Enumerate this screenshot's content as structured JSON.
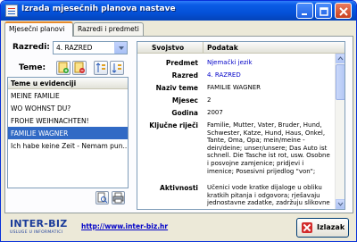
{
  "window": {
    "title": "Izrada mjesečnih planova nastave"
  },
  "tabs": [
    {
      "label": "Mjesečni planovi"
    },
    {
      "label": "Razredi i predmeti"
    }
  ],
  "razredi": {
    "label": "Razredi:",
    "selected": "4. RAZRED"
  },
  "teme": {
    "label": "Teme:"
  },
  "list": {
    "header": "Teme u evidenciji",
    "items": [
      "MEINE FAMILIE",
      "WO WOHNST DU?",
      "FROHE WEIHNACHTEN!",
      "FAMILIE WAGNER",
      "Ich habe keine Zeit - Nemam pun..."
    ],
    "selected_index": 3
  },
  "grid": {
    "col_svojstvo": "Svojstvo",
    "col_podatak": "Podatak",
    "rows": [
      {
        "key": "Predmet",
        "value": "Njemački jezik"
      },
      {
        "key": "Razred",
        "value": "4. RAZRED"
      },
      {
        "key": "Naziv teme",
        "value": "FAMILIE WAGNER"
      },
      {
        "key": "Mjesec",
        "value": "2"
      },
      {
        "key": "Godina",
        "value": "2007"
      },
      {
        "key": "Ključne riječi",
        "value": "Familie, Mutter, Vater, Bruder, Hund, Schwester, Katze, Hund, Haus, Onkel, Tante, Oma, Opa; mein/meine - dein/deine; unser/unsere; Das Auto ist schnell. Die Tasche ist rot, usw. Osobne i posvojne zamjenice; pridjevi i imenice; Posesivni prijedlog \"von\";"
      },
      {
        "key": "Aktivnosti",
        "value": "Učenici vode kratke dijaloge u obliku kratkih pitanja i odgovora; rješavaju jednostavne zadatke, zadržuju slikovne"
      }
    ]
  },
  "footer": {
    "logo": "INTER-BIZ",
    "logo_sub": "USLUGE U INFORMATICI",
    "link": "http://www.inter-biz.hr",
    "exit_label": "Izlazak"
  }
}
